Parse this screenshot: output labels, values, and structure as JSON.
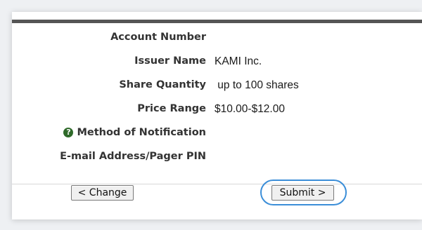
{
  "form": {
    "fields": [
      {
        "label": "Account Number",
        "value": ""
      },
      {
        "label": "Issuer Name",
        "value": "KAMI Inc."
      },
      {
        "label": "Share Quantity",
        "value": " up to 100 shares"
      },
      {
        "label": "Price Range",
        "value": "$10.00-$12.00"
      },
      {
        "label": "Method of Notification",
        "value": "",
        "icon": "help-icon"
      },
      {
        "label": "E-mail Address/Pager PIN",
        "value": ""
      }
    ]
  },
  "actions": {
    "change_label": "< Change",
    "submit_label": "Submit >"
  },
  "colors": {
    "rule": "#555555",
    "focus_ring": "#3b8ed8",
    "help_icon": "#2f6a2a"
  }
}
